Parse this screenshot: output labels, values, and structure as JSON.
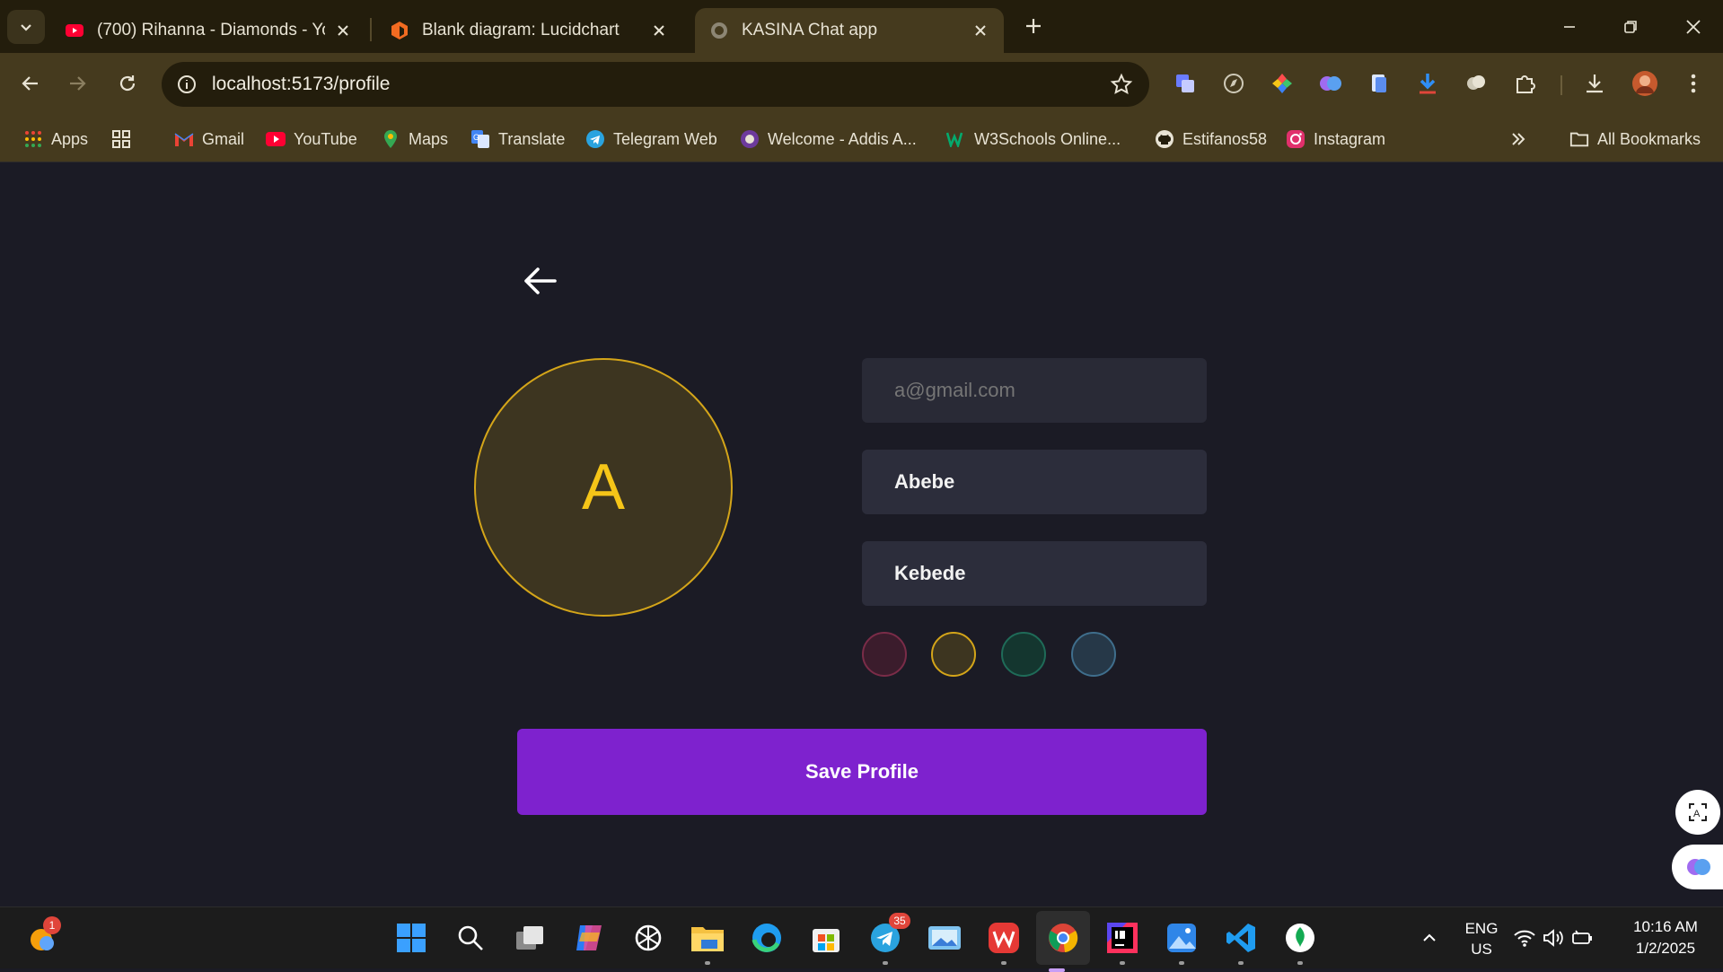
{
  "browser": {
    "tabs": [
      {
        "title": "(700) Rihanna - Diamonds - YouTube",
        "favicon": "youtube-icon",
        "active": false
      },
      {
        "title": "Blank diagram: Lucidchart",
        "favicon": "lucidchart-icon",
        "active": false
      },
      {
        "title": "KASINA Chat app",
        "favicon": "globe-icon",
        "active": true
      }
    ],
    "url": "localhost:5173/profile",
    "bookmarks": [
      {
        "label": "Apps",
        "icon": "apps-grid-icon"
      },
      {
        "label": "Gmail",
        "icon": "gmail-icon"
      },
      {
        "label": "YouTube",
        "icon": "youtube-icon"
      },
      {
        "label": "Maps",
        "icon": "maps-icon"
      },
      {
        "label": "Translate",
        "icon": "translate-icon"
      },
      {
        "label": "Telegram Web",
        "icon": "telegram-icon"
      },
      {
        "label": "Welcome - Addis A...",
        "icon": "university-icon"
      },
      {
        "label": "W3Schools Online...",
        "icon": "w3schools-icon"
      },
      {
        "label": "Estifanos58",
        "icon": "github-icon"
      },
      {
        "label": "Instagram",
        "icon": "instagram-icon"
      }
    ],
    "all_bookmarks_label": "All Bookmarks"
  },
  "profile": {
    "avatar_initial": "A",
    "email_placeholder": "a@gmail.com",
    "first_name": "Abebe",
    "last_name": "Kebede",
    "color_options": [
      {
        "name": "rose",
        "fill": "#3b1c2c",
        "border": "#7a2c48"
      },
      {
        "name": "amber",
        "fill": "#3d3520",
        "border": "#d4a519"
      },
      {
        "name": "teal",
        "fill": "#14362f",
        "border": "#1f6b58"
      },
      {
        "name": "slate-blue",
        "fill": "#263848",
        "border": "#3f6e8c"
      }
    ],
    "selected_color": "amber",
    "save_label": "Save Profile"
  },
  "colors": {
    "accent": "#7e22ce",
    "avatar_text": "#f5c518"
  },
  "taskbar": {
    "weather_badge": "1",
    "telegram_badge": "35",
    "language": "ENG",
    "region": "US",
    "time": "10:16 AM",
    "date": "1/2/2025"
  }
}
